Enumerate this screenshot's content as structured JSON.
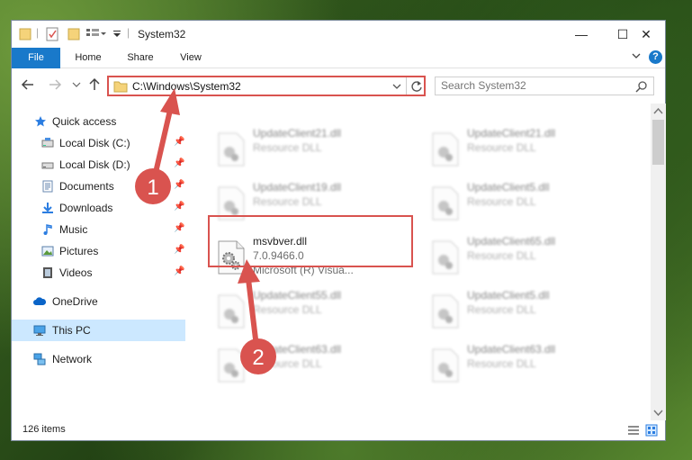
{
  "window": {
    "title": "System32"
  },
  "window_controls": {
    "minimize": "—",
    "maximize": "☐",
    "close": "✕"
  },
  "ribbon": {
    "tabs": [
      "File",
      "Home",
      "Share",
      "View"
    ],
    "help_icon": "?"
  },
  "address_bar": {
    "path": "C:\\Windows\\System32"
  },
  "search": {
    "placeholder": "Search System32"
  },
  "navigation": {
    "items": [
      {
        "label": "Quick access",
        "icon": "star-icon",
        "pinned": false
      },
      {
        "label": "Local Disk (C:)",
        "icon": "drive-icon",
        "pinned": true
      },
      {
        "label": "Local Disk (D:)",
        "icon": "drive-icon",
        "pinned": true
      },
      {
        "label": "Documents",
        "icon": "documents-icon",
        "pinned": true
      },
      {
        "label": "Downloads",
        "icon": "downloads-icon",
        "pinned": true
      },
      {
        "label": "Music",
        "icon": "music-icon",
        "pinned": true
      },
      {
        "label": "Pictures",
        "icon": "pictures-icon",
        "pinned": true
      },
      {
        "label": "Videos",
        "icon": "videos-icon",
        "pinned": true
      },
      {
        "label": "OneDrive",
        "icon": "cloud-icon",
        "pinned": false
      },
      {
        "label": "This PC",
        "icon": "computer-icon",
        "pinned": false,
        "selected": true
      },
      {
        "label": "Network",
        "icon": "network-icon",
        "pinned": false
      }
    ]
  },
  "files": [
    {
      "name": "UpdateClient21.dll",
      "type": "Resource DLL",
      "blurred": true
    },
    {
      "name": "UpdateClient21.dll",
      "type": "Resource DLL",
      "blurred": true
    },
    {
      "name": "UpdateClient19.dll",
      "type": "Resource DLL",
      "blurred": true
    },
    {
      "name": "UpdateClient5.dll",
      "type": "Resource DLL",
      "blurred": true
    },
    {
      "name": "msvbver.dll",
      "version": "7.0.9466.0",
      "type": "Microsoft (R) Visua...",
      "blurred": false,
      "highlighted": true
    },
    {
      "name": "UpdateClient65.dll",
      "type": "Resource DLL",
      "blurred": true
    },
    {
      "name": "UpdateClient55.dll",
      "type": "Resource DLL",
      "blurred": true
    },
    {
      "name": "UpdateClient5.dll",
      "type": "Resource DLL",
      "blurred": true
    },
    {
      "name": "UpdateClient63.dll",
      "type": "Resource DLL",
      "blurred": true
    },
    {
      "name": "UpdateClient63.dll",
      "type": "Resource DLL",
      "blurred": true
    }
  ],
  "status": {
    "item_count": "126 items"
  },
  "annotations": {
    "step1": "1",
    "step2": "2",
    "color": "#d9534f"
  }
}
